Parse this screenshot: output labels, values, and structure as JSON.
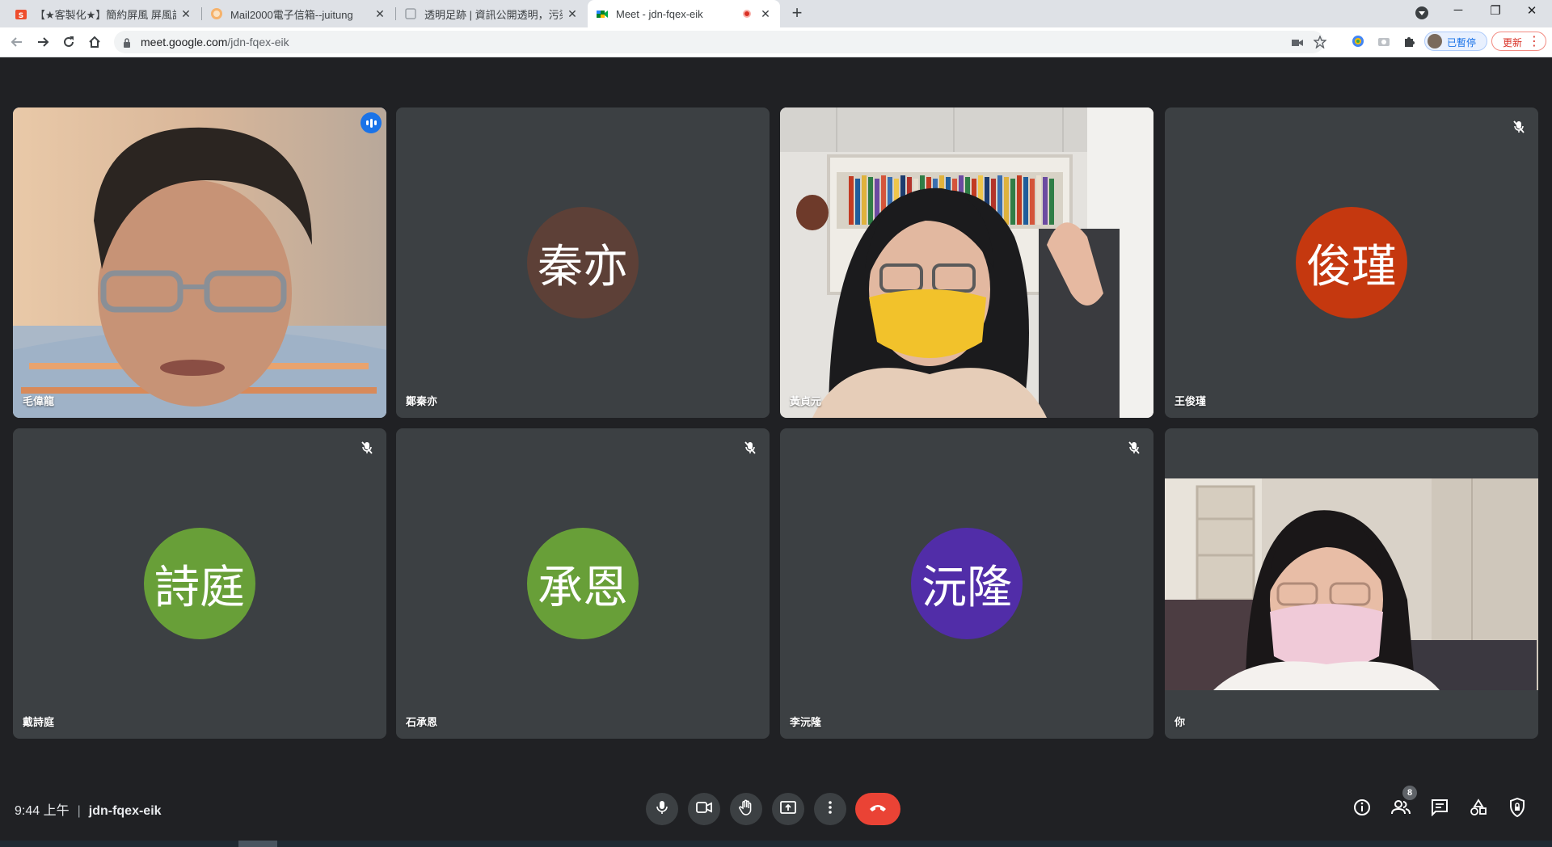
{
  "browser": {
    "tabs": [
      {
        "title": "【★客製化★】簡約屏風 屏風訂製",
        "active": false,
        "recording": false
      },
      {
        "title": "Mail2000電子信箱--juitung",
        "active": false,
        "recording": false
      },
      {
        "title": "透明足跡 | 資訊公開透明，污染無",
        "active": false,
        "recording": false
      },
      {
        "title": "Meet - jdn-fqex-eik",
        "active": true,
        "recording": true
      }
    ],
    "url_host": "meet.google.com",
    "url_path": "/jdn-fqex-eik",
    "profile_label": "已暫停",
    "update_label": "更新"
  },
  "meeting": {
    "time": "9:44 上午",
    "code": "jdn-fqex-eik",
    "participant_count": "8",
    "participants": [
      {
        "name": "毛偉龍",
        "initials": "",
        "avatar_color": "",
        "muted": false,
        "speaking": true,
        "video": true
      },
      {
        "name": "鄭秦亦",
        "initials": "秦亦",
        "avatar_color": "#5d4037",
        "muted": false,
        "speaking": false,
        "video": false
      },
      {
        "name": "黃貞元",
        "initials": "",
        "avatar_color": "",
        "muted": false,
        "speaking": false,
        "video": true
      },
      {
        "name": "王俊瑾",
        "initials": "俊瑾",
        "avatar_color": "#c5380f",
        "muted": true,
        "speaking": false,
        "video": false
      },
      {
        "name": "戴詩庭",
        "initials": "詩庭",
        "avatar_color": "#689f38",
        "muted": true,
        "speaking": false,
        "video": false
      },
      {
        "name": "石承恩",
        "initials": "承恩",
        "avatar_color": "#689f38",
        "muted": true,
        "speaking": false,
        "video": false
      },
      {
        "name": "李沅隆",
        "initials": "沅隆",
        "avatar_color": "#512da8",
        "muted": true,
        "speaking": false,
        "video": false
      },
      {
        "name": "你",
        "initials": "",
        "avatar_color": "",
        "muted": false,
        "speaking": false,
        "video": true
      }
    ]
  },
  "colors": {
    "background": "#202124",
    "tile": "#3c4043",
    "speaking_border": "#8ab4f8",
    "end_call": "#ea4335"
  },
  "icons": [
    "back-icon",
    "forward-icon",
    "reload-icon",
    "home-icon",
    "lock-icon",
    "camera-blocked-icon",
    "star-icon",
    "extensions-icon",
    "microphone-icon",
    "camera-icon",
    "raise-hand-icon",
    "present-icon",
    "more-options-icon",
    "end-call-icon",
    "info-icon",
    "people-icon",
    "chat-icon",
    "activities-icon",
    "host-controls-icon",
    "mic-off-icon"
  ]
}
